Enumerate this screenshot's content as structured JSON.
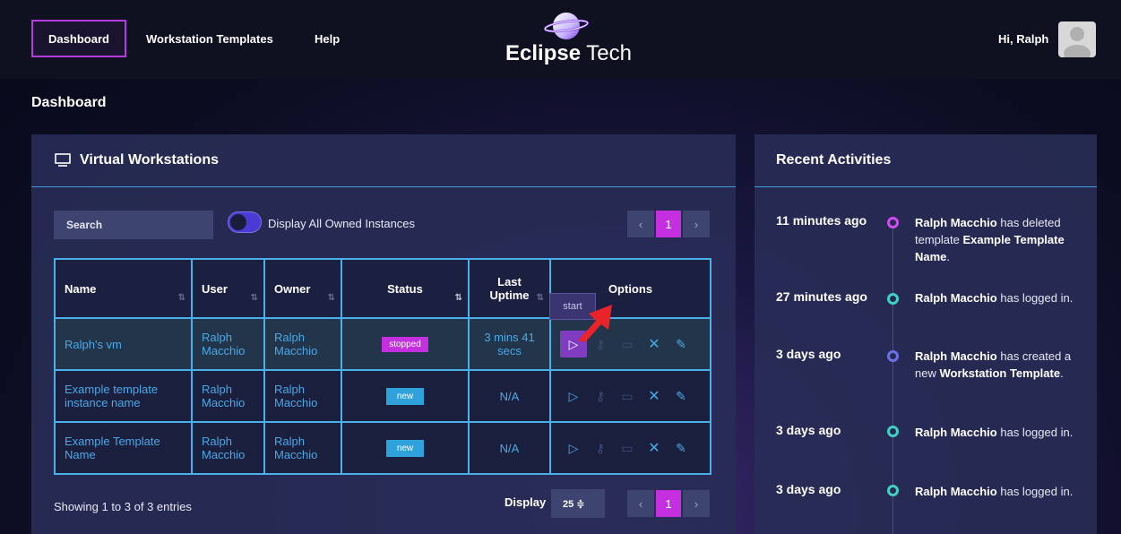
{
  "nav": {
    "dashboard": "Dashboard",
    "templates": "Workstation Templates",
    "help": "Help"
  },
  "brand": {
    "bold": "Eclipse",
    "light": " Tech"
  },
  "user": {
    "greeting": "Hi, Ralph"
  },
  "page": {
    "title": "Dashboard"
  },
  "workstations": {
    "title": "Virtual Workstations",
    "search_placeholder": "Search",
    "toggle_label": "Display All Owned Instances",
    "pagination": {
      "prev": "‹",
      "current": "1",
      "next": "›"
    },
    "columns": [
      "Name",
      "User",
      "Owner",
      "Status",
      "Last Uptime",
      "Options"
    ],
    "rows": [
      {
        "name": "Ralph's vm",
        "user": "Ralph Macchio",
        "owner": "Ralph Macchio",
        "status": "stopped",
        "uptime": "3 mins 41 secs"
      },
      {
        "name": "Example template instance name",
        "user": "Ralph Macchio",
        "owner": "Ralph Macchio",
        "status": "new",
        "uptime": "N/A"
      },
      {
        "name": "Example Template Name",
        "user": "Ralph Macchio",
        "owner": "Ralph Macchio",
        "status": "new",
        "uptime": "N/A"
      }
    ],
    "tooltip": "start",
    "showing": "Showing 1 to 3 of 3 entries",
    "display_label": "Display",
    "display_value": "25 ≑"
  },
  "activities": {
    "title": "Recent Activities",
    "items": [
      {
        "time": "11 minutes ago",
        "actor": "Ralph Macchio",
        "pre": " has deleted template ",
        "object": "Example Template Name",
        "post": ".",
        "dot": "#d14cf0"
      },
      {
        "time": "27 minutes ago",
        "actor": "Ralph Macchio",
        "pre": " has logged in.",
        "object": "",
        "post": "",
        "dot": "#3fd1c4"
      },
      {
        "time": "3 days ago",
        "actor": "Ralph Macchio",
        "pre": " has created a new ",
        "object": "Workstation Template",
        "post": ".",
        "dot": "#6b72e8"
      },
      {
        "time": "3 days ago",
        "actor": "Ralph Macchio",
        "pre": " has logged in.",
        "object": "",
        "post": "",
        "dot": "#3fd1c4"
      },
      {
        "time": "3 days ago",
        "actor": "Ralph Macchio",
        "pre": " has logged in.",
        "object": "",
        "post": "",
        "dot": "#3fd1c4"
      }
    ]
  },
  "colors": {
    "accent": "#c42fe0",
    "link": "#4aa8e6",
    "border": "#4ab0ea",
    "arrow": "#e8232a"
  }
}
